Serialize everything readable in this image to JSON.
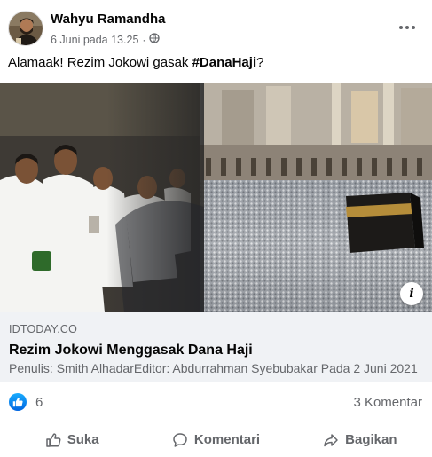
{
  "post": {
    "author": "Wahyu Ramandha",
    "timestamp": "6 Juni pada 13.25",
    "separator": "·",
    "audience_icon": "globe-icon",
    "text_before": "Alamaak! Rezim Jokowi gasak ",
    "hashtag": "#DanaHaji",
    "text_after": "?"
  },
  "link_preview": {
    "domain": "IDTODAY.CO",
    "title": "Rezim Jokowi Menggasak Dana Haji",
    "description": "Penulis: Smith AlhadarEditor: Abdurrahman Syebubakar Pada 2 Juni 2021",
    "info_label": "i"
  },
  "stats": {
    "reaction_icon": "like-icon",
    "reaction_count": "6",
    "comment_count": "3 Komentar"
  },
  "actions": {
    "like": "Suka",
    "comment": "Komentari",
    "share": "Bagikan"
  },
  "colors": {
    "accent": "#1877f2",
    "secondary_text": "#65676b",
    "link_bg": "#f0f2f5"
  }
}
